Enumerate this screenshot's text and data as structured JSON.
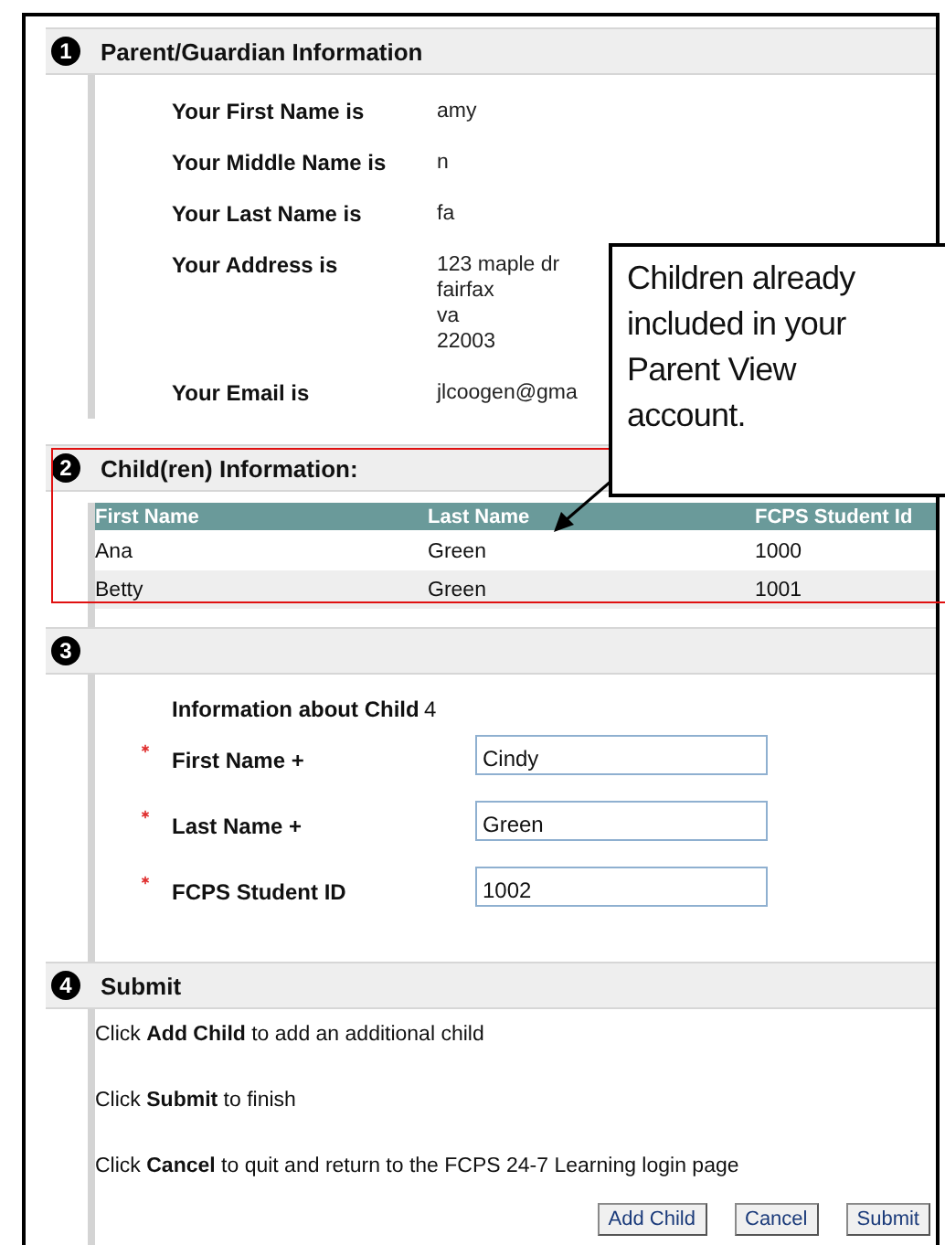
{
  "sections": [
    {
      "kind": "info",
      "number": "1",
      "title": "Parent/Guardian Information",
      "fields": [
        {
          "label": "Your First Name is",
          "lines": [
            "amy"
          ]
        },
        {
          "label": "Your Middle Name is",
          "lines": [
            "n"
          ]
        },
        {
          "label": "Your Last Name is",
          "lines": [
            "fa"
          ]
        },
        {
          "label": "Your Address is",
          "lines": [
            "123 maple dr",
            "fairfax",
            "va",
            "22003"
          ]
        },
        {
          "label": "Your Email is",
          "lines": [
            "jlcoogen@gma"
          ]
        }
      ]
    },
    {
      "kind": "table",
      "number": "2",
      "title": "Child(ren) Information:",
      "columns": [
        "First Name",
        "Last Name",
        "FCPS Student Id"
      ],
      "rows": [
        [
          "Ana",
          "Green",
          "1000"
        ],
        [
          "Betty",
          "Green",
          "1001"
        ]
      ]
    },
    {
      "kind": "form",
      "number": "3",
      "caption": {
        "label": "Information about Child",
        "value": "4"
      },
      "fields": [
        {
          "label": "First Name +",
          "value": "Cindy",
          "required": true
        },
        {
          "label": "Last Name +",
          "value": "Green",
          "required": true
        },
        {
          "label": "FCPS Student ID",
          "value": "1002",
          "required": true
        }
      ]
    },
    {
      "kind": "submit",
      "number": "4",
      "title": "Submit",
      "notes": [
        "Click **Add Child** to add an additional child",
        "Click **Submit** to finish",
        "Click **Cancel** to quit and return to the FCPS 24-7 Learning login page"
      ],
      "buttons": [
        "Add Child",
        "Cancel",
        "Submit"
      ]
    }
  ],
  "callout": {
    "lines": [
      "Children already",
      "included in your",
      "Parent View",
      "account."
    ]
  }
}
